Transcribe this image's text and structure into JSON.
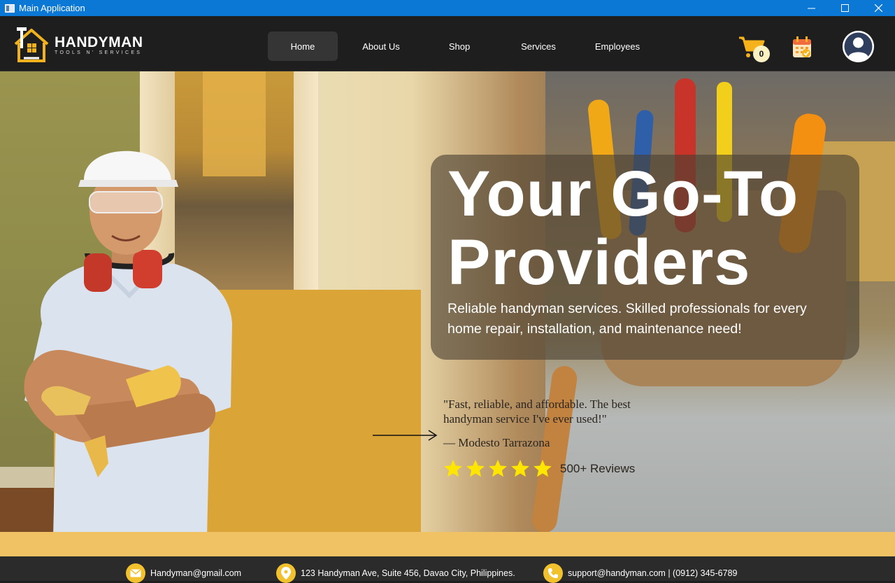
{
  "window": {
    "title": "Main Application",
    "controls": {
      "minimize": "—",
      "maximize": "☐",
      "close": "✕"
    }
  },
  "logo": {
    "title": "HANDYMAN",
    "subtitle": "TOOLS N' SERVICES"
  },
  "nav": {
    "items": [
      {
        "label": "Home",
        "active": true
      },
      {
        "label": "About Us"
      },
      {
        "label": "Shop"
      },
      {
        "label": "Services"
      },
      {
        "label": "Employees"
      }
    ]
  },
  "cart": {
    "count": "0",
    "icon": "cart-icon"
  },
  "calendar": {
    "icon": "calendar-icon"
  },
  "profile": {
    "icon": "avatar-icon"
  },
  "hero": {
    "title_line1": "Your Go-To",
    "title_line2": "Providers",
    "subtitle": "Reliable handyman services. Skilled professionals for every home repair, installation, and maintenance need!",
    "quote": "\"Fast, reliable, and affordable. The best handyman service I've ever used!\"",
    "quote_author": "— Modesto Tarrazona",
    "rating_stars": 5,
    "reviews": "500+ Reviews"
  },
  "footer": {
    "email": "Handyman@gmail.com",
    "address": "123 Handyman Ave, Suite 456, Davao City, Philippines.",
    "support": "support@handyman.com | (0912) 345-6789"
  },
  "colors": {
    "accent": "#f2c12e",
    "titlebar": "#0a78d4",
    "navbar": "#1e1e1e",
    "gold_block": "#dba436",
    "strip": "#f1c263",
    "star": "#ffe600"
  }
}
